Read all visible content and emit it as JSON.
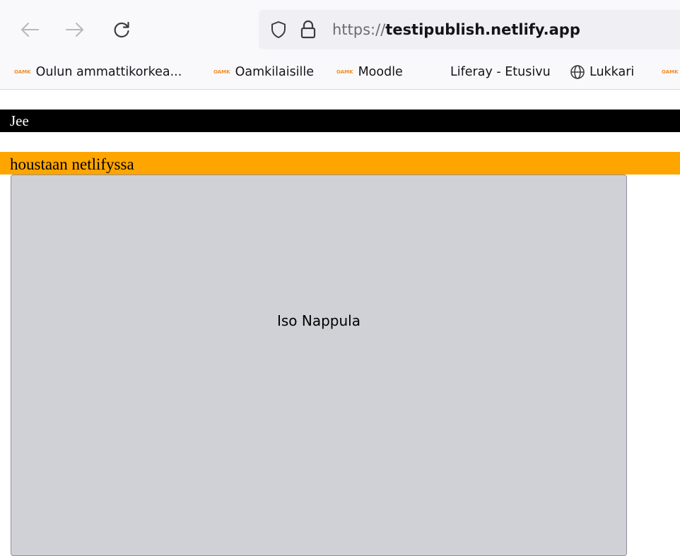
{
  "browser": {
    "url_scheme": "https://",
    "url_domain": "testipublish.netlify.app",
    "nav_icons": [
      "arrow-left-icon",
      "arrow-right-icon",
      "reload-icon"
    ],
    "security_icons": [
      "shield-icon",
      "lock-icon"
    ]
  },
  "bookmarks": [
    {
      "label": "Oulun ammattikorkea...",
      "badge": "OAMK",
      "icon": "oamk-logo-icon"
    },
    {
      "label": "Oamkilaisille",
      "badge": "OAMK",
      "icon": "oamk-logo-icon"
    },
    {
      "label": "Moodle",
      "badge": "OAMK",
      "icon": "oamk-logo-icon"
    },
    {
      "label": "Liferay - Etusivu",
      "icon": "none"
    },
    {
      "label": "Lukkari",
      "icon": "globe-icon"
    },
    {
      "label": "",
      "badge": "OAMK",
      "icon": "oamk-logo-icon"
    }
  ],
  "page": {
    "black_bar_text": "Jee",
    "orange_bar_text": "houstaan netlifyssa",
    "big_button_label": "Iso Nappula"
  },
  "colors": {
    "black_bar_bg": "#000000",
    "orange_bar_bg": "#ffa500",
    "button_bg": "#d0d0d7",
    "oamk_badge": "#f28c28"
  }
}
